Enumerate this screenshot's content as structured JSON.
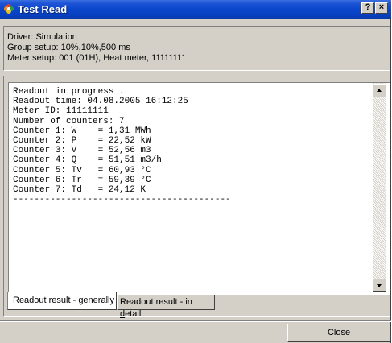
{
  "window": {
    "title": "Test Read",
    "help_button": "?",
    "close_button": "×"
  },
  "info": {
    "driver": "Driver: Simulation",
    "group_setup": "Group setup: 10%,10%,500 ms",
    "meter_setup": "Meter setup: 001 (01H), Heat meter, 11111111"
  },
  "readout": {
    "lines": [
      "Readout in progress .",
      "Readout time: 04.08.2005 16:12:25",
      "Meter ID: 11111111",
      "Number of counters: 7",
      "Counter 1: W    = 1,31 MWh",
      "Counter 2: P    = 22,52 kW",
      "Counter 3: V    = 52,56 m3",
      "Counter 4: Q    = 51,51 m3/h",
      "Counter 5: Tv   = 60,93 °C",
      "Counter 6: Tr   = 59,39 °C",
      "Counter 7: Td   = 24,12 K",
      "-----------------------------------------"
    ]
  },
  "tabs": {
    "generally": "Readout result - generally",
    "detail_prefix": "Readout result - in ",
    "detail_accel": "d",
    "detail_suffix": "etail"
  },
  "buttons": {
    "close": "Close"
  }
}
